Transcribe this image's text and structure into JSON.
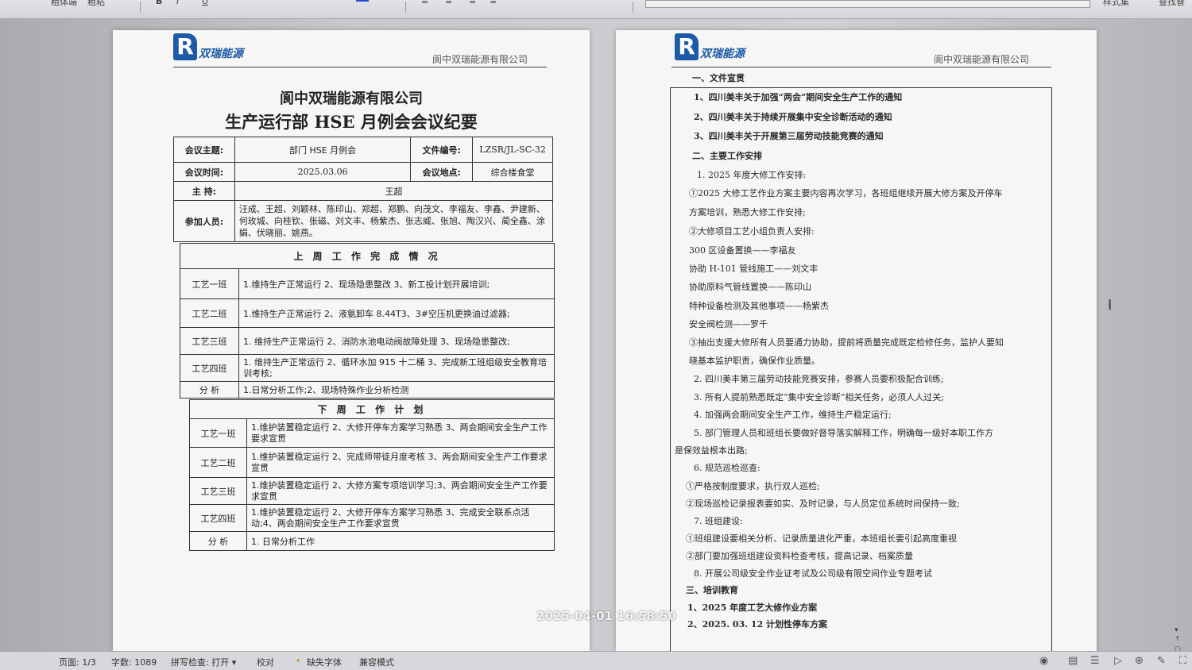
{
  "ribbon": {
    "items": [
      "粗体端",
      "粗粘",
      "样式集",
      "查找替"
    ]
  },
  "left_page": {
    "logo_text": "双瑞能源",
    "header_company": "阆中双瑞能源有限公司",
    "title1": "阆中双瑞能源有限公司",
    "title2": "生产运行部 HSE 月例会会议纪要",
    "info": {
      "topic_label": "会议主题:",
      "topic_value": "部门 HSE 月例会",
      "doc_no_label": "文件编号:",
      "doc_no_value": "LZSR/JL-SC-32",
      "time_label": "会议时间:",
      "time_value": "2025.03.06",
      "place_label": "会议地点:",
      "place_value": "综合楼食堂",
      "host_label": "主 持:",
      "host_value": "王超",
      "attendees_label": "参加人员:",
      "attendees_value": "汪成、王超、刘颖林、陈印山、郑超、郑鹏、向茂文、李福友、李鑫、尹建新、何玫城、向桂钦、张磁、刘文丰、杨紫杰、张志威、张旭、陶汉兴、蔺全鑫、涂娟、伏晓丽、姚燕。"
    },
    "last_week": {
      "heading": "上 周 工 作 完 成 情 况",
      "rows": [
        {
          "team": "工艺一班",
          "content": "1.维持生产正常运行 2、现场隐患整改 3、新工投计划开展培训;"
        },
        {
          "team": "工艺二班",
          "content": "1.维持生产正常运行 2、液氨卸车 8.44T3、3#空压机更换油过滤器;"
        },
        {
          "team": "工艺三班",
          "content": "1. 维持生产正常运行 2、消防水池电动阀故障处理 3、现场隐患整改;"
        },
        {
          "team": "工艺四班",
          "content": "1. 维持生产正常运行 2、循环水加 915 十二桶 3、完成新工班组级安全教育培训考核;"
        },
        {
          "team": "分 析",
          "content": "1.日常分析工作;2、现场特殊作业分析检测"
        }
      ]
    },
    "next_week": {
      "heading": "下 周 工 作 计 划",
      "rows": [
        {
          "team": "工艺一班",
          "content": "1.维护装置稳定运行 2、大修开停车方案学习熟悉 3、两会期间安全生产工作要求宣贯"
        },
        {
          "team": "工艺二班",
          "content": "1.维护装置稳定运行 2、完成师带徒月度考核 3、两会期间安全生产工作要求宣贯"
        },
        {
          "team": "工艺三班",
          "content": "1.维护装置稳定运行 2、大修方案专项培训学习;3、两会期间安全生产工作要求宣贯"
        },
        {
          "team": "工艺四班",
          "content": "1.维护装置稳定运行 2、大修开停车方案学习熟悉 3、完成安全联系点活动;4、两会期间安全生产工作要求宣贯"
        },
        {
          "team": "分 析",
          "content": "1. 日常分析工作"
        }
      ]
    }
  },
  "right_page": {
    "logo_text": "双瑞能源",
    "header_company": "阆中双瑞能源有限公司",
    "lines": [
      "一、文件宣贯",
      "1、四川美丰关于加强“两会”期间安全生产工作的通知",
      "2、四川美丰关于持续开展集中安全诊断活动的通知",
      "3、四川美丰关于开展第三届劳动技能竞赛的通知",
      "二、主要工作安排",
      "1. 2025 年度大修工作安排:",
      "①2025 大修工艺作业方案主要内容再次学习，各班组继续开展大修方案及开停车",
      "方案培训，熟悉大修工作安排;",
      "②大修项目工艺小组负责人安排:",
      "300 区设备置换——李福友",
      "协助 H-101 管线施工——刘文丰",
      "协助原料气管线置换——陈印山",
      "特种设备检测及其他事项——杨紫杰",
      "安全阀检测——罗千",
      "③抽出支援大修所有人员要通力协助，提前将质量完成既定检修任务，监护人要知",
      "晓基本监护职责，确保作业质量。",
      "2. 四川美丰第三届劳动技能竞赛安排，参赛人员要积极配合训练;",
      "3. 所有人提前熟悉既定“集中安全诊断”相关任务，必须人人过关;",
      "4. 加强两会期间安全生产工作，维持生产稳定运行;",
      "5. 部门管理人员和班组长要做好督导落实解释工作，明确每一级好本职工作方",
      "是保效益根本出路;",
      "6. 规范巡检巡查:",
      "①严格按制度要求，执行双人巡检;",
      "②现场巡检记录报表要如实、及时记录，与人员定位系统时间保持一致;",
      "7. 班组建设:",
      "①班组建设要相关分析、记录质量进化严重，本班组长要引起高度重视",
      "②部门要加强班组建设资料检查考核，提高记录、档案质量",
      "8. 开展公司级安全作业证考试及公司级有限空间作业专题考试",
      "三、培训教育",
      "1、2025 年度工艺大修作业方案",
      "2、2025. 03. 12 计划性停车方案"
    ]
  },
  "timestamp": "2025-04-01 16:58:50",
  "statusbar": {
    "page": "页面: 1/3",
    "words": "字数: 1089",
    "spell": "拼写检查: 打开 ▾",
    "proof": "校对",
    "missing_font": "缺失字体",
    "compat": "兼容模式"
  }
}
